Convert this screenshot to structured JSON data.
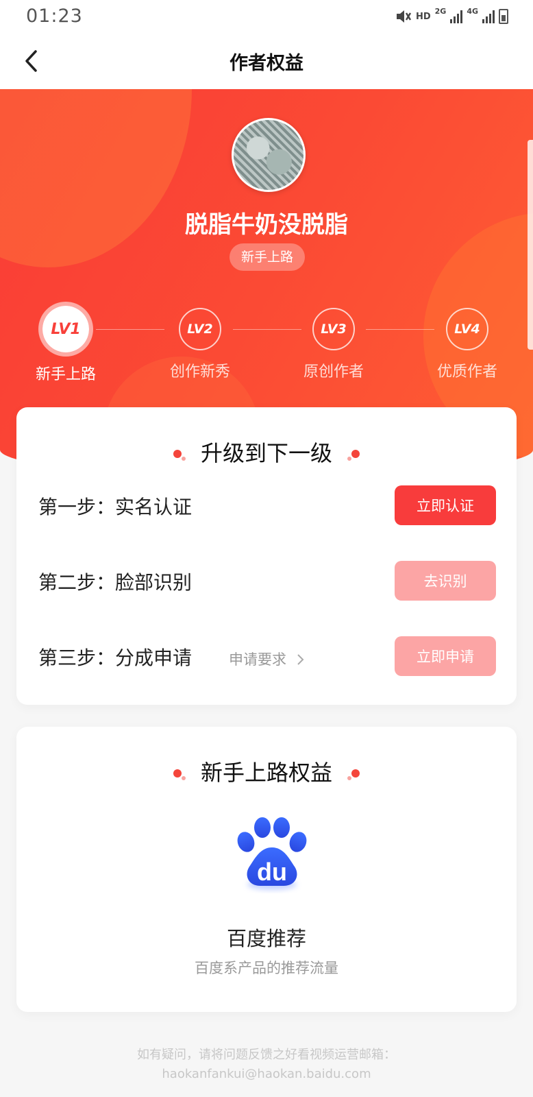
{
  "status_bar": {
    "time": "01:23",
    "hd_label": "HD",
    "net1_label": "2G",
    "net2_label": "4G"
  },
  "nav": {
    "title": "作者权益"
  },
  "profile": {
    "name": "脱脂牛奶没脱脂",
    "badge": "新手上路"
  },
  "levels": [
    {
      "code": "LV1",
      "label": "新手上路",
      "active": true
    },
    {
      "code": "LV2",
      "label": "创作新秀",
      "active": false
    },
    {
      "code": "LV3",
      "label": "原创作者",
      "active": false
    },
    {
      "code": "LV4",
      "label": "优质作者",
      "active": false
    }
  ],
  "upgrade": {
    "title": "升级到下一级",
    "steps": [
      {
        "label": "第一步：实名认证",
        "button": "立即认证",
        "enabled": true
      },
      {
        "label": "第二步：脸部识别",
        "button": "去识别",
        "enabled": false
      },
      {
        "label": "第三步：分成申请",
        "requirement": "申请要求",
        "button": "立即申请",
        "enabled": false
      }
    ]
  },
  "benefits": {
    "title": "新手上路权益",
    "item": {
      "icon": "baidu-paw-icon",
      "logo_text": "du",
      "name": "百度推荐",
      "desc": "百度系产品的推荐流量"
    }
  },
  "footer": {
    "line1": "如有疑问，请将问题反馈之好看视频运营邮箱：",
    "line2": "haokanfankui@haokan.baidu.com"
  },
  "colors": {
    "accent": "#f83c3c",
    "accent_disabled": "#fca5a5",
    "hero_start": "#f93c36",
    "hero_end": "#ff5e33",
    "baidu_blue": "#2f54eb"
  }
}
